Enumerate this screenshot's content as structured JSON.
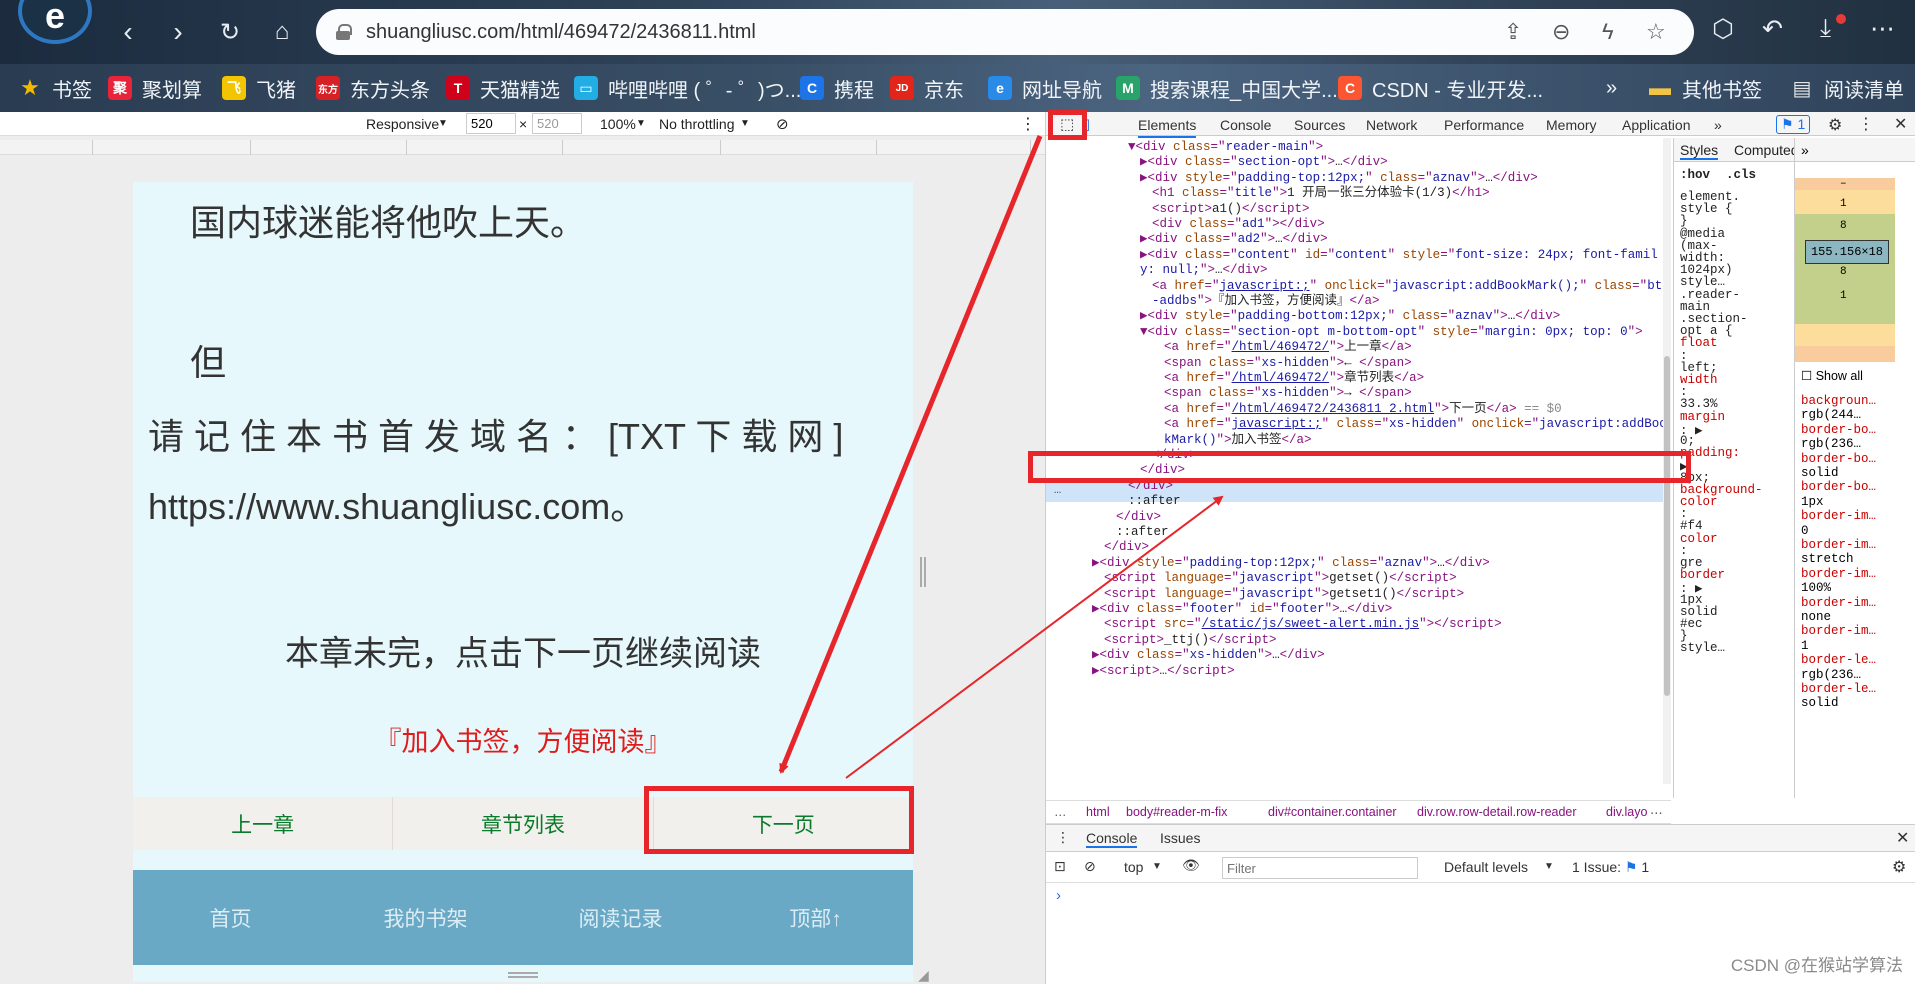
{
  "browser": {
    "url": "shuangliusc.com/html/469472/2436811.html"
  },
  "bookmarks": [
    {
      "label": "书签",
      "icon": "star-icon",
      "color": "#f5b800"
    },
    {
      "label": "聚划算",
      "icon": "juhuasuan-icon",
      "color": "#e8243a",
      "glyph": "聚"
    },
    {
      "label": "飞猪",
      "icon": "fliggy-icon",
      "color": "#f3c400",
      "glyph": "飞"
    },
    {
      "label": "东方头条",
      "icon": "dongfang-icon",
      "color": "#d71f26",
      "glyph": "东方"
    },
    {
      "label": "天猫精选",
      "icon": "tmall-icon",
      "color": "#d0021b",
      "glyph": "T"
    },
    {
      "label": "哔哩哔哩 ( ゜- ゜)つ...",
      "icon": "bilibili-icon",
      "color": "#23ade5",
      "glyph": "▭"
    },
    {
      "label": "携程",
      "icon": "ctrip-icon",
      "color": "#1d74e7",
      "glyph": "C"
    },
    {
      "label": "京东",
      "icon": "jd-icon",
      "color": "#e1251b",
      "glyph": "JD"
    },
    {
      "label": "网址导航",
      "icon": "navigation-icon",
      "color": "#2a8ae8",
      "glyph": "e"
    },
    {
      "label": "搜索课程_中国大学...",
      "icon": "mooc-icon",
      "color": "#2aa36b",
      "glyph": "M"
    },
    {
      "label": "CSDN - 专业开发...",
      "icon": "csdn-icon",
      "color": "#fc5531",
      "glyph": "C"
    },
    {
      "label": "»",
      "icon": "more-bookmarks-icon"
    },
    {
      "label": "其他书签",
      "icon": "folder-icon",
      "color": "#f3c547"
    },
    {
      "label": "阅读清单",
      "icon": "reading-list-icon",
      "color": "#e6e6e6"
    }
  ],
  "device_toolbar": {
    "mode": "Responsive",
    "width": "520",
    "height": "520",
    "zoom": "100%",
    "throttling": "No throttling"
  },
  "page": {
    "line1": "国内球迷能将他吹上天。",
    "line2": "但",
    "line3": "请 记 住 本 书 首 发 域 名 ： [TXT 下 载 网 ]",
    "line4": "https://www.shuangliusc.com。",
    "notice": "本章未完，点击下一页继续阅读",
    "bookmark_link": "『加入书签，方便阅读』",
    "nav": [
      "上一章",
      "章节列表",
      "下一页"
    ],
    "footer": [
      "首页",
      "我的书架",
      "阅读记录",
      "顶部↑"
    ]
  },
  "devtools": {
    "tabs": [
      "Elements",
      "Console",
      "Sources",
      "Network",
      "Performance",
      "Memory",
      "Application",
      "»"
    ],
    "issues_badge": "1",
    "styles_tabs": [
      "Styles",
      "Computed",
      "»"
    ],
    "filter_hov": ":hov",
    "filter_cls": ".cls",
    "breadcrumb": [
      "html",
      "body#reader-m-fix",
      "div#container.container",
      "div.row.row-detail.row-reader",
      "div.layo"
    ],
    "console_tabs": [
      "Console",
      "Issues"
    ],
    "console_context": "top",
    "console_filter_placeholder": "Filter",
    "console_levels": "Default levels",
    "console_issues": "1 Issue:",
    "console_issues_count": "1",
    "show_all": "Show all"
  },
  "dom_lines": [
    {
      "indent": 72,
      "html": "▼<span>&lt;div </span><span class='at'>class</span>=\"<span class='av'>reader-main</span>\"&gt;"
    },
    {
      "indent": 84,
      "html": "▶&lt;div <span class='at'>class</span>=\"<span class='av'>section-opt</span>\"&gt;<span class='tx'>…</span>&lt;/div&gt;"
    },
    {
      "indent": 84,
      "html": "▶&lt;div <span class='at'>style</span>=\"<span class='av'>padding-top:12px;</span>\" <span class='at'>class</span>=\"<span class='av'>aznav</span>\"&gt;<span class='tx'>…</span>&lt;/div&gt;"
    },
    {
      "indent": 96,
      "html": "&lt;h1 <span class='at'>class</span>=\"<span class='av'>title</span>\"&gt;<span class='tx'>1 开局一张三分体验卡(1/3)</span>&lt;/h1&gt;"
    },
    {
      "indent": 96,
      "html": "&lt;script&gt;<span class='tx'>a1()</span>&lt;/script&gt;"
    },
    {
      "indent": 96,
      "html": "&lt;div <span class='at'>class</span>=\"<span class='av'>ad1</span>\"&gt;&lt;/div&gt;"
    },
    {
      "indent": 84,
      "html": "▶&lt;div <span class='at'>class</span>=\"<span class='av'>ad2</span>\"&gt;<span class='tx'>…</span>&lt;/div&gt;"
    },
    {
      "indent": 84,
      "html": "▶&lt;div <span class='at'>class</span>=\"<span class='av'>content</span>\" <span class='at'>id</span>=\"<span class='av'>content</span>\" <span class='at'>style</span>=\"<span class='av'>font-size: 24px; font-famil</span>"
    },
    {
      "indent": 84,
      "html": "<span class='av'>y: null;</span>\"&gt;<span class='tx'>…</span>&lt;/div&gt;"
    },
    {
      "indent": 96,
      "html": "&lt;a <span class='at'>href</span>=\"<span class='lk'>javascript:;</span>\" <span class='at'>onclick</span>=\"<span class='av'>javascript:addBookMark();</span>\" <span class='at'>class</span>=\"<span class='av'>btn</span>"
    },
    {
      "indent": 96,
      "html": "<span class='av'>-addbs</span>\"&gt;<span class='tx'>『加入书签，方便阅读』</span>&lt;/a&gt;"
    },
    {
      "indent": 84,
      "html": "▶&lt;div <span class='at'>style</span>=\"<span class='av'>padding-bottom:12px;</span>\" <span class='at'>class</span>=\"<span class='av'>aznav</span>\"&gt;<span class='tx'>…</span>&lt;/div&gt;"
    },
    {
      "indent": 84,
      "html": "▼&lt;div <span class='at'>class</span>=\"<span class='av'>section-opt m-bottom-opt</span>\" <span class='at'>style</span>=\"<span class='av'>margin: 0px; top: 0</span>\"&gt;"
    },
    {
      "indent": 108,
      "html": "&lt;a <span class='at'>href</span>=\"<span class='lk'>/html/469472/</span>\"&gt;<span class='tx'>上一章</span>&lt;/a&gt;"
    },
    {
      "indent": 108,
      "html": "&lt;span <span class='at'>class</span>=\"<span class='av'>xs-hidden</span>\"&gt;<span class='tx'>← </span>&lt;/span&gt;"
    },
    {
      "indent": 108,
      "html": "&lt;a <span class='at'>href</span>=\"<span class='lk'>/html/469472/</span>\"&gt;<span class='tx'>章节列表</span>&lt;/a&gt;"
    },
    {
      "indent": 108,
      "html": "&lt;span <span class='at'>class</span>=\"<span class='av'>xs-hidden</span>\"&gt;<span class='tx'>→ </span>&lt;/span&gt;"
    },
    {
      "indent": 108,
      "html": "&lt;a <span class='at'>href</span>=\"<span class='lk'>/html/469472/2436811_2.html</span>\"&gt;<span class='tx'>下一页</span>&lt;/a&gt; <span class='cm'>== $0</span>"
    },
    {
      "indent": 108,
      "html": "&lt;a <span class='at'>href</span>=\"<span class='lk'>javascript:;</span>\" <span class='at'>class</span>=\"<span class='av'>xs-hidden</span>\" <span class='at'>onclick</span>=\"<span class='av'>javascript:addBoo</span>"
    },
    {
      "indent": 108,
      "html": "<span class='av'>kMark()</span>\"&gt;<span class='tx'>加入书签</span>&lt;/a&gt;"
    },
    {
      "indent": 96,
      "html": "&lt;/div&gt;"
    },
    {
      "indent": 84,
      "html": "&lt;/div&gt;"
    },
    {
      "indent": 72,
      "html": "&lt;/div&gt;"
    },
    {
      "indent": 72,
      "html": "<span class='tx'>::after</span>"
    },
    {
      "indent": 60,
      "html": "&lt;/div&gt;"
    },
    {
      "indent": 60,
      "html": "<span class='tx'>::after</span>"
    },
    {
      "indent": 48,
      "html": "&lt;/div&gt;"
    },
    {
      "indent": 36,
      "html": "▶&lt;div <span class='at'>style</span>=\"<span class='av'>padding-top:12px;</span>\" <span class='at'>class</span>=\"<span class='av'>aznav</span>\"&gt;<span class='tx'>…</span>&lt;/div&gt;"
    },
    {
      "indent": 48,
      "html": "&lt;script <span class='at'>language</span>=\"<span class='av'>javascript</span>\"&gt;<span class='tx'>getset()</span>&lt;/script&gt;"
    },
    {
      "indent": 48,
      "html": "&lt;script <span class='at'>language</span>=\"<span class='av'>javascript</span>\"&gt;<span class='tx'>getset1()</span>&lt;/script&gt;"
    },
    {
      "indent": 36,
      "html": "▶&lt;div <span class='at'>class</span>=\"<span class='av'>footer</span>\" <span class='at'>id</span>=\"<span class='av'>footer</span>\"&gt;<span class='tx'>…</span>&lt;/div&gt;"
    },
    {
      "indent": 48,
      "html": "&lt;script <span class='at'>src</span>=\"<span class='lk'>/static/js/sweet-alert.min.js</span>\"&gt;&lt;/script&gt;"
    },
    {
      "indent": 48,
      "html": "&lt;script&gt;<span class='tx'>_ttj()</span>&lt;/script&gt;"
    },
    {
      "indent": 36,
      "html": "▶&lt;div <span class='at'>class</span>=\"<span class='av'>xs-hidden</span>\"&gt;<span class='tx'>…</span>&lt;/div&gt;"
    },
    {
      "indent": 36,
      "html": "▶&lt;script&gt;<span class='tx'>…</span>&lt;/script&gt;"
    }
  ],
  "styles_lines": [
    "element.",
    "style {",
    "}",
    "@media",
    "(max-",
    "width:",
    "1024px)",
    "style…",
    ".reader-",
    "main",
    ".section-",
    "opt a {",
    "float",
    ":",
    "left;",
    "width",
    ":",
    "33.3%",
    "margin",
    ": ▶",
    "0;",
    "padding:",
    "▶",
    "8px;",
    "background-",
    "color",
    ":",
    "#f4",
    "color",
    ":",
    "gre",
    "border",
    ": ▶",
    "1px",
    "solid",
    "#ec",
    "}",
    "style…"
  ],
  "box_model": {
    "border": "1",
    "padding": "8",
    "content": "155.156×18",
    "margin": "–"
  },
  "computed_props": [
    "backgroun…",
    "rgb(244…",
    "border-bo…",
    "rgb(236…",
    "border-bo…",
    "solid",
    "border-bo…",
    "1px",
    "border-im…",
    "0",
    "border-im…",
    "stretch",
    "border-im…",
    "100%",
    "border-im…",
    "none",
    "border-im…",
    "1",
    "border-le…",
    "rgb(236…",
    "border-le…",
    "solid"
  ],
  "watermark": "CSDN @在猴站学算法"
}
